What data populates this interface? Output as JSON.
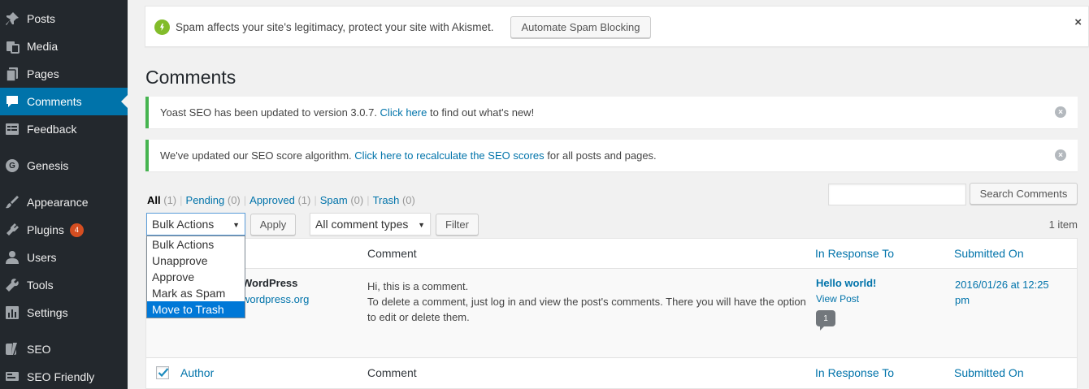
{
  "sidebar": {
    "items": [
      {
        "label": "Posts",
        "icon": "pin-icon"
      },
      {
        "label": "Media",
        "icon": "media-icon"
      },
      {
        "label": "Pages",
        "icon": "pages-icon"
      },
      {
        "label": "Comments",
        "icon": "comments-icon",
        "current": true
      },
      {
        "label": "Feedback",
        "icon": "feedback-icon"
      },
      {
        "label": "Genesis",
        "icon": "genesis-icon"
      },
      {
        "label": "Appearance",
        "icon": "appearance-icon"
      },
      {
        "label": "Plugins",
        "icon": "plugins-icon",
        "badge": "4"
      },
      {
        "label": "Users",
        "icon": "users-icon"
      },
      {
        "label": "Tools",
        "icon": "tools-icon"
      },
      {
        "label": "Settings",
        "icon": "settings-icon"
      },
      {
        "label": "SEO",
        "icon": "yoast-icon"
      },
      {
        "label": "SEO Friendly",
        "icon": "seo-friendly-icon"
      }
    ]
  },
  "akismet": {
    "text": "Spam affects your site's legitimacy, protect your site with Akismet.",
    "button": "Automate Spam Blocking",
    "close": "×"
  },
  "page_title": "Comments",
  "notices": [
    {
      "before": "Yoast SEO has been updated to version 3.0.7. ",
      "link": "Click here",
      "after": " to find out what's new!"
    },
    {
      "before": "We've updated our SEO score algorithm. ",
      "link": "Click here to recalculate the SEO scores",
      "after": " for all posts and pages."
    }
  ],
  "filters": {
    "all": "All",
    "all_count": "(1)",
    "pending": "Pending",
    "pending_count": "(0)",
    "approved": "Approved",
    "approved_count": "(1)",
    "spam": "Spam",
    "spam_count": "(0)",
    "trash": "Trash",
    "trash_count": "(0)",
    "separator": "|"
  },
  "search": {
    "placeholder": "",
    "button": "Search Comments"
  },
  "bulk": {
    "selected": "Bulk Actions",
    "apply": "Apply",
    "options": [
      "Bulk Actions",
      "Unapprove",
      "Approve",
      "Mark as Spam",
      "Move to Trash"
    ],
    "highlighted_index": 4
  },
  "type_filter": {
    "selected": "All comment types",
    "button": "Filter"
  },
  "item_count": "1 item",
  "table": {
    "headers": {
      "author": "Author",
      "comment": "Comment",
      "response": "In Response To",
      "submitted": "Submitted On"
    },
    "row": {
      "author_name": "WordPress",
      "author_url": "wordpress.org",
      "comment_line1": "Hi, this is a comment.",
      "comment_line2": "To delete a comment, just log in and view the post's comments. There you will have the option to edit or delete them.",
      "response_title": "Hello world!",
      "view_post": "View Post",
      "comment_count": "1",
      "submitted": "2016/01/26 at 12:25 pm"
    }
  },
  "colors": {
    "accent": "#0073aa",
    "sidebar": "#23282d",
    "notice_success": "#46b450",
    "akismet": "#82bc2a",
    "badge": "#d54e21"
  }
}
